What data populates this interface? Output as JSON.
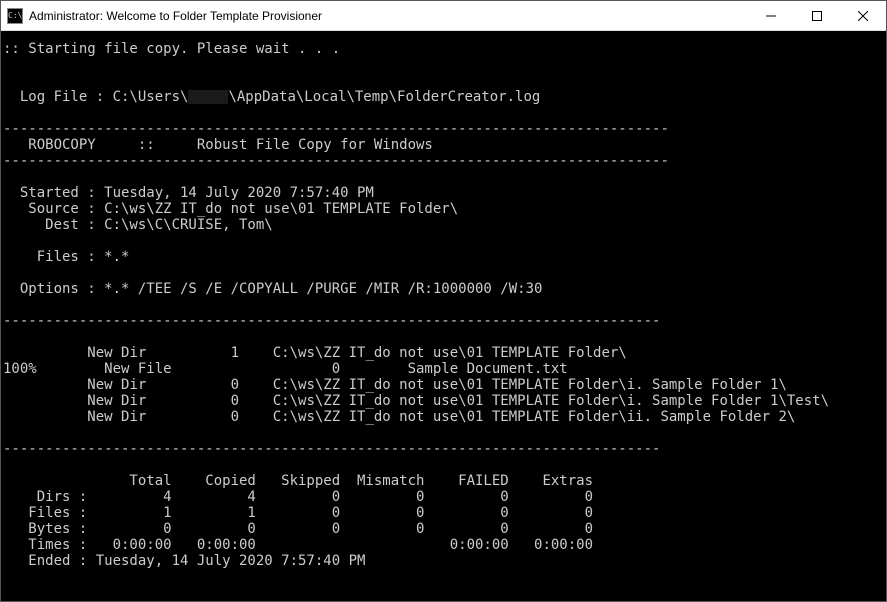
{
  "titlebar": {
    "icon_glyph": "C:\\",
    "title": "Administrator:  Welcome to Folder Template Provisioner"
  },
  "window_controls": {
    "minimize": "minimize",
    "maximize": "maximize",
    "close": "close"
  },
  "console": {
    "starting_line": ":: Starting file copy. Please wait . . .",
    "blank": "",
    "logfile_left": "  Log File : C:\\Users\\",
    "logfile_right": "\\AppData\\Local\\Temp\\FolderCreator.log",
    "divider": "-------------------------------------------------------------------------------",
    "robocopy_header": "   ROBOCOPY     ::     Robust File Copy for Windows",
    "started": "  Started : Tuesday, 14 July 2020 7:57:40 PM",
    "source": "   Source : C:\\ws\\ZZ IT_do not use\\01 TEMPLATE Folder\\",
    "dest": "     Dest : C:\\ws\\C\\CRUISE, Tom\\",
    "files": "    Files : *.*",
    "options": "  Options : *.* /TEE /S /E /COPYALL /PURGE /MIR /R:1000000 /W:30",
    "divider2": "------------------------------------------------------------------------------",
    "body_l1": "\t  New Dir          1    C:\\ws\\ZZ IT_do not use\\01 TEMPLATE Folder\\",
    "body_l2": "100%\t    New File  \t\t       0\tSample Document.txt",
    "body_l3": "\t  New Dir          0    C:\\ws\\ZZ IT_do not use\\01 TEMPLATE Folder\\i. Sample Folder 1\\",
    "body_l4": "\t  New Dir          0    C:\\ws\\ZZ IT_do not use\\01 TEMPLATE Folder\\i. Sample Folder 1\\Test\\",
    "body_l5": "\t  New Dir          0    C:\\ws\\ZZ IT_do not use\\01 TEMPLATE Folder\\ii. Sample Folder 2\\",
    "stats_header": "               Total    Copied   Skipped  Mismatch    FAILED    Extras",
    "stats_dirs": "    Dirs :         4         4         0         0         0         0",
    "stats_files": "   Files :         1         1         0         0         0         0",
    "stats_bytes": "   Bytes :         0         0         0         0         0         0",
    "stats_times": "   Times :   0:00:00   0:00:00                       0:00:00   0:00:00",
    "ended": "   Ended : Tuesday, 14 July 2020 7:57:40 PM"
  },
  "chart_data": {
    "type": "table",
    "title": "Robocopy summary",
    "columns": [
      "Total",
      "Copied",
      "Skipped",
      "Mismatch",
      "FAILED",
      "Extras"
    ],
    "rows": [
      {
        "label": "Dirs",
        "values": [
          4,
          4,
          0,
          0,
          0,
          0
        ]
      },
      {
        "label": "Files",
        "values": [
          1,
          1,
          0,
          0,
          0,
          0
        ]
      },
      {
        "label": "Bytes",
        "values": [
          0,
          0,
          0,
          0,
          0,
          0
        ]
      },
      {
        "label": "Times",
        "values": [
          "0:00:00",
          "0:00:00",
          "",
          "",
          "0:00:00",
          "0:00:00"
        ]
      }
    ],
    "started": "Tuesday, 14 July 2020 7:57:40 PM",
    "ended": "Tuesday, 14 July 2020 7:57:40 PM"
  }
}
